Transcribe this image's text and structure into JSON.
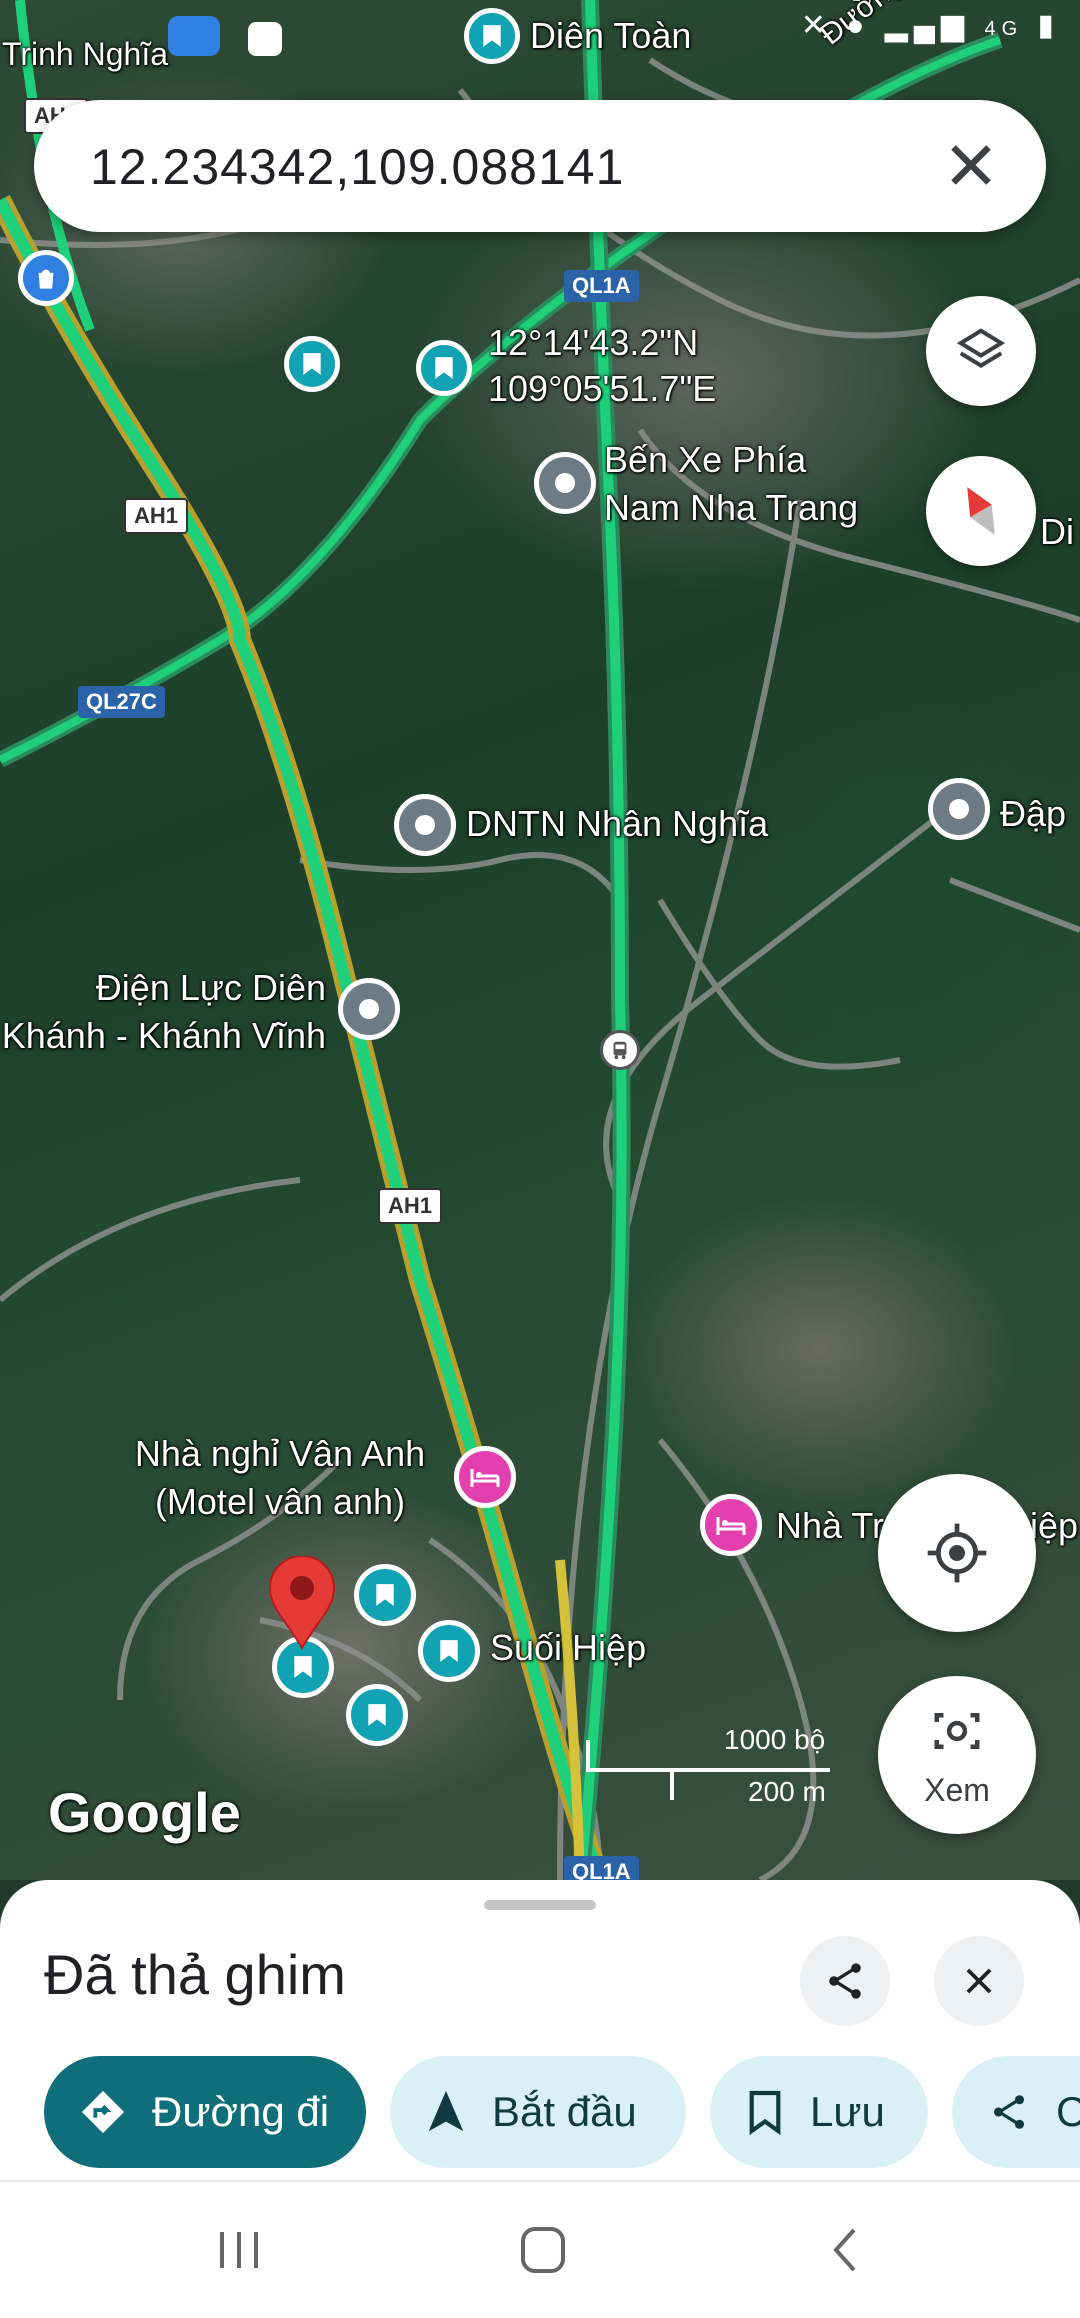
{
  "status_bar": {
    "time": "",
    "icons": [
      "zalo-icon",
      "mute-icon",
      "location-icon",
      "signal-icon",
      "battery-icon"
    ],
    "network_label": "4G"
  },
  "search": {
    "value": "12.234342,109.088141"
  },
  "map": {
    "coordinates_dms": "12°14'43.2\"N\n109°05'51.7\"E",
    "places": {
      "dien_toan": "Diên Toàn",
      "ben_xe": "Bến Xe Phía\nNam Nha Trang",
      "dntn": "DNTN Nhân Nghĩa",
      "dap": "Đập",
      "dien_luc": "Điện Lực Diên\nKhánh - Khánh Vĩnh",
      "nha_nghi": "Nhà nghỉ Vân Anh\n(Motel vân anh)",
      "nha_tr": "Nhà Tr",
      "nha_tr_suffix": "iệp",
      "suoi_hiep": "Suối Hiệp",
      "di_label": "Di",
      "duong_vo": "Đường Võ",
      "top_left_cut": "Trinh Nghĩa"
    },
    "road_shields": {
      "ah1": "AH1",
      "ql1a": "QL1A",
      "ql27c": "QL27C"
    },
    "scale": {
      "feet": "1000 bộ",
      "meters": "200 m"
    },
    "attribution": "Google",
    "colors": {
      "highway": "#1fd07a",
      "highway_alt": "#d5c23a",
      "pin_teal": "#11a3b4",
      "pin_gray": "#6d7b86",
      "pin_pink": "#e33fae",
      "drop_pin": "#e53935"
    }
  },
  "controls": {
    "explore_label": "Xem"
  },
  "sheet": {
    "title": "Đã thả ghim",
    "buttons": {
      "directions": "Đường đi",
      "start": "Bắt đầu",
      "save": "Lưu",
      "share": "C"
    }
  }
}
